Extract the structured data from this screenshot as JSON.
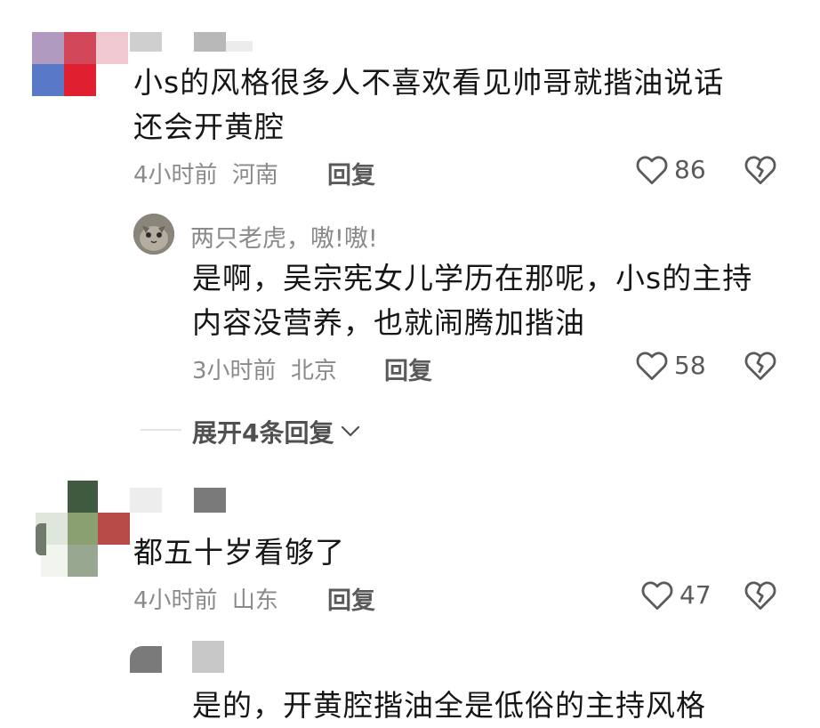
{
  "comments": [
    {
      "text_line1": "小s的风格很多人不喜欢看见帅哥就揩油说话",
      "text_line2": "还会开黄腔",
      "time": "4小时前",
      "location": "河南",
      "reply_label": "回复",
      "likes": "86"
    },
    {
      "text_line1": "都五十岁看够了",
      "time": "4小时前",
      "location": "山东",
      "reply_label": "回复",
      "likes": "47"
    }
  ],
  "replies": [
    {
      "username": "两只老虎，嗷!嗷!",
      "text_line1": "是啊，吴宗宪女儿学历在那呢，小s的主持",
      "text_line2": "内容没营养，也就闹腾加揩油",
      "time": "3小时前",
      "location": "北京",
      "reply_label": "回复",
      "likes": "58"
    },
    {
      "text_line1": "是的，开黄腔揩油全是低俗的主持风格"
    }
  ],
  "expand_label": "展开4条回复",
  "icons": {
    "like": "heart-outline-icon",
    "dislike": "broken-heart-icon",
    "expand": "chevron-down-icon"
  },
  "colors": {
    "text": "#161616",
    "meta": "#8a8a8a",
    "icon": "#5a5a5a"
  }
}
